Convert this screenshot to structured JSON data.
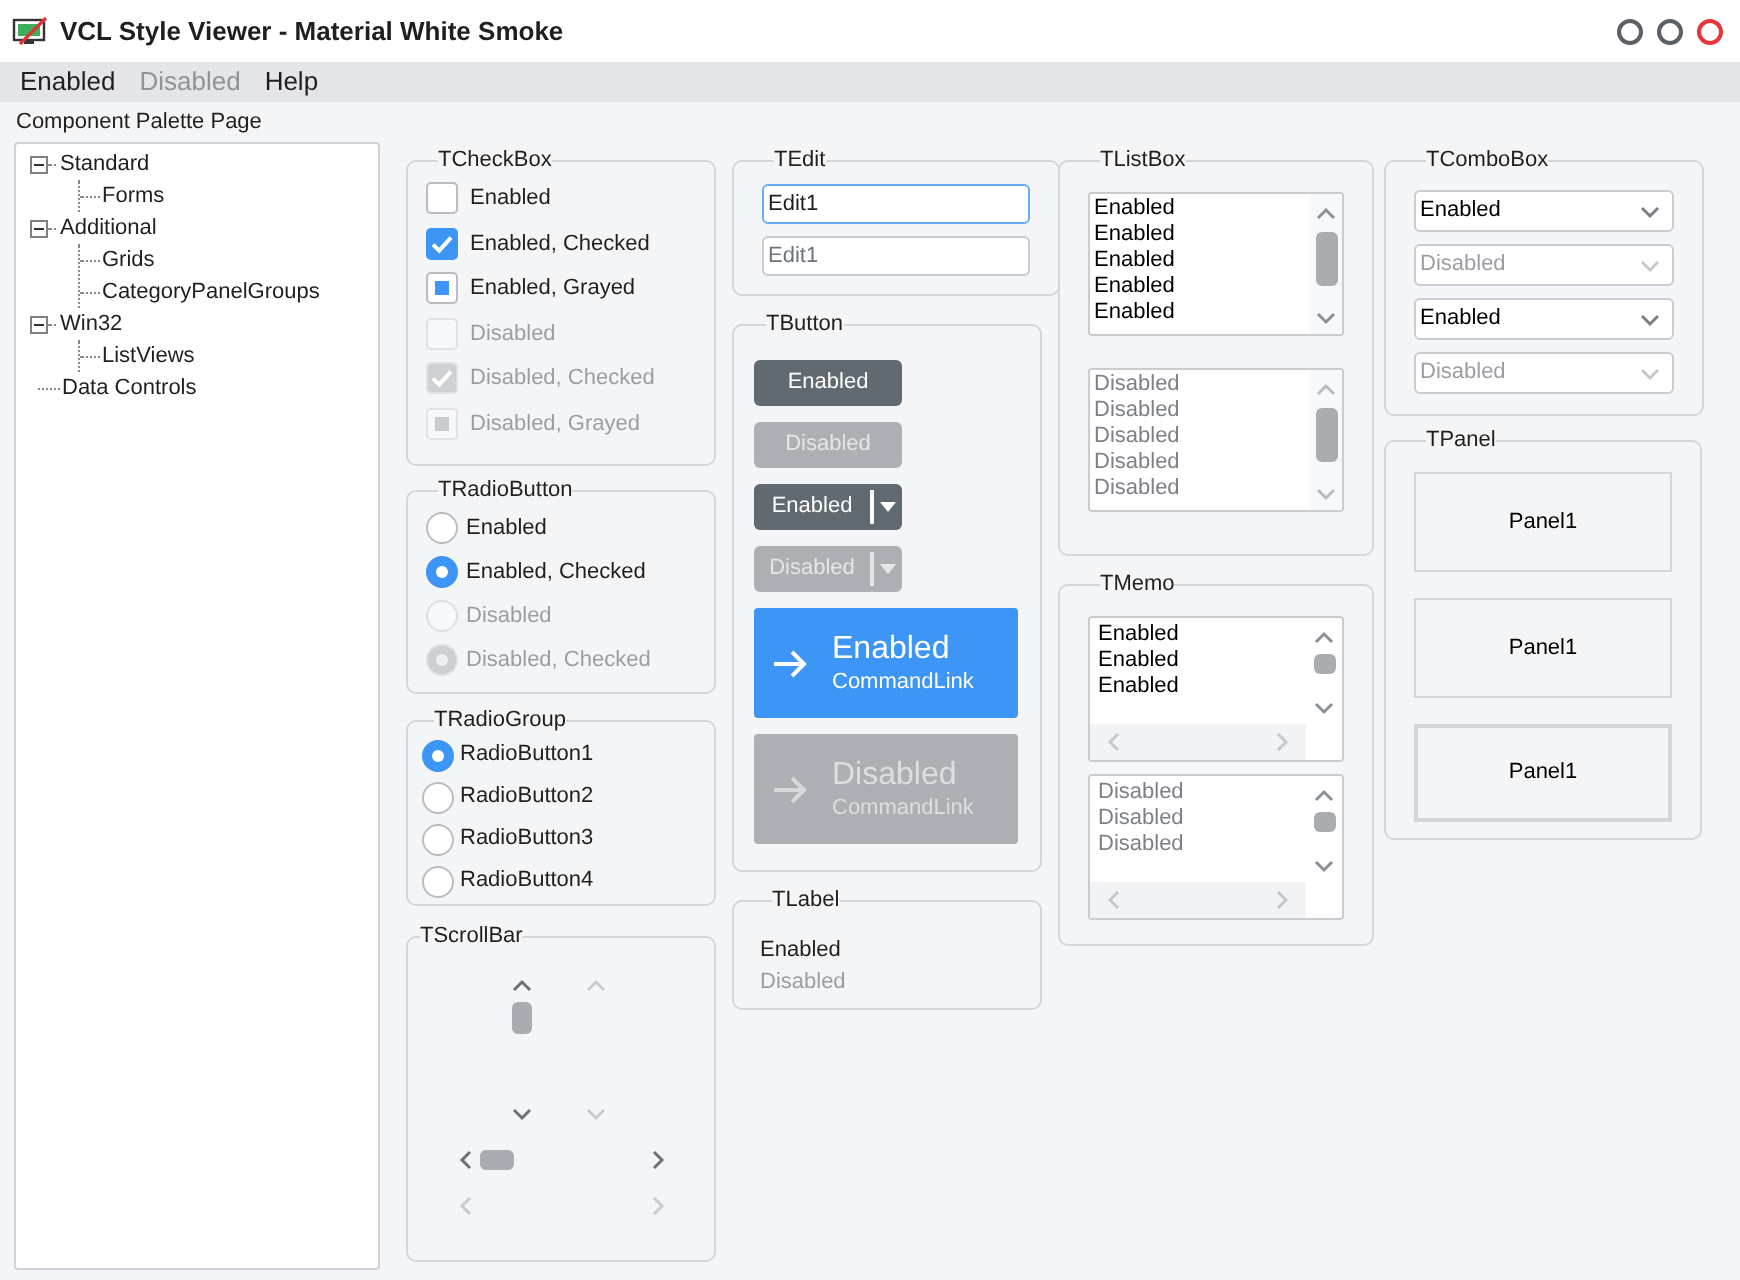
{
  "window": {
    "title": "VCL Style Viewer - Material White Smoke"
  },
  "menu": [
    {
      "label": "Enabled",
      "disabled": false
    },
    {
      "label": "Disabled",
      "disabled": true
    },
    {
      "label": "Help",
      "disabled": false
    }
  ],
  "palette": {
    "label": "Component Palette Page",
    "tree": [
      {
        "label": "Standard",
        "expanded": true,
        "children": [
          {
            "label": "Forms"
          }
        ]
      },
      {
        "label": "Additional",
        "expanded": true,
        "children": [
          {
            "label": "Grids"
          },
          {
            "label": "CategoryPanelGroups"
          }
        ]
      },
      {
        "label": "Win32",
        "expanded": true,
        "children": [
          {
            "label": "ListViews"
          }
        ]
      },
      {
        "label": "Data Controls"
      }
    ]
  },
  "checkboxes": {
    "title": "TCheckBox",
    "items": [
      {
        "label": "Enabled",
        "checked": false,
        "grayed": false,
        "disabled": false
      },
      {
        "label": "Enabled, Checked",
        "checked": true,
        "grayed": false,
        "disabled": false
      },
      {
        "label": "Enabled, Grayed",
        "checked": false,
        "grayed": true,
        "disabled": false
      },
      {
        "label": "Disabled",
        "checked": false,
        "grayed": false,
        "disabled": true
      },
      {
        "label": "Disabled, Checked",
        "checked": true,
        "grayed": false,
        "disabled": true
      },
      {
        "label": "Disabled, Grayed",
        "checked": false,
        "grayed": true,
        "disabled": true
      }
    ]
  },
  "radio_buttons": {
    "title": "TRadioButton",
    "items": [
      {
        "label": "Enabled",
        "checked": false,
        "disabled": false
      },
      {
        "label": "Enabled, Checked",
        "checked": true,
        "disabled": false
      },
      {
        "label": "Disabled",
        "checked": false,
        "disabled": true
      },
      {
        "label": "Disabled, Checked",
        "checked": true,
        "disabled": true
      }
    ]
  },
  "radio_group": {
    "title": "TRadioGroup",
    "items": [
      {
        "label": "RadioButton1",
        "selected": true
      },
      {
        "label": "RadioButton2",
        "selected": false
      },
      {
        "label": "RadioButton3",
        "selected": false
      },
      {
        "label": "RadioButton4",
        "selected": false
      }
    ]
  },
  "scroll_bars": {
    "title": "TScrollBar",
    "vertical": [
      {
        "disabled": false
      },
      {
        "disabled": true
      }
    ],
    "horizontal": [
      {
        "disabled": false
      },
      {
        "disabled": true
      }
    ]
  },
  "edits": {
    "title": "TEdit",
    "items": [
      {
        "value": "Edit1",
        "focused": true,
        "disabled": false
      },
      {
        "value": "Edit1",
        "focused": false,
        "disabled": true
      }
    ]
  },
  "buttons": {
    "title": "TButton",
    "items": [
      {
        "kind": "push",
        "label": "Enabled",
        "disabled": false
      },
      {
        "kind": "push",
        "label": "Disabled",
        "disabled": true
      },
      {
        "kind": "split",
        "label": "Enabled",
        "disabled": false
      },
      {
        "kind": "split",
        "label": "Disabled",
        "disabled": true
      },
      {
        "kind": "command_link",
        "label": "Enabled",
        "note": "CommandLink",
        "disabled": false
      },
      {
        "kind": "command_link",
        "label": "Disabled",
        "note": "CommandLink",
        "disabled": true
      }
    ]
  },
  "labels": {
    "title": "TLabel",
    "items": [
      {
        "text": "Enabled",
        "disabled": false
      },
      {
        "text": "Disabled",
        "disabled": true
      }
    ]
  },
  "list_boxes": {
    "title": "TListBox",
    "items": [
      {
        "disabled": false,
        "lines": [
          "Enabled",
          "Enabled",
          "Enabled",
          "Enabled",
          "Enabled"
        ]
      },
      {
        "disabled": true,
        "lines": [
          "Disabled",
          "Disabled",
          "Disabled",
          "Disabled",
          "Disabled"
        ]
      }
    ]
  },
  "memos": {
    "title": "TMemo",
    "items": [
      {
        "disabled": false,
        "lines": [
          "Enabled",
          "Enabled",
          "Enabled"
        ]
      },
      {
        "disabled": true,
        "lines": [
          "Disabled",
          "Disabled",
          "Disabled"
        ]
      }
    ]
  },
  "combo_boxes": {
    "title": "TComboBox",
    "items": [
      {
        "value": "Enabled",
        "disabled": false
      },
      {
        "value": "Disabled",
        "disabled": true
      },
      {
        "value": "Enabled",
        "disabled": false
      },
      {
        "value": "Disabled",
        "disabled": true
      }
    ]
  },
  "panels": {
    "title": "TPanel",
    "items": [
      {
        "caption": "Panel1",
        "kind": "flat"
      },
      {
        "caption": "Panel1",
        "kind": "flat"
      },
      {
        "caption": "Panel1",
        "kind": "lowered"
      }
    ]
  }
}
